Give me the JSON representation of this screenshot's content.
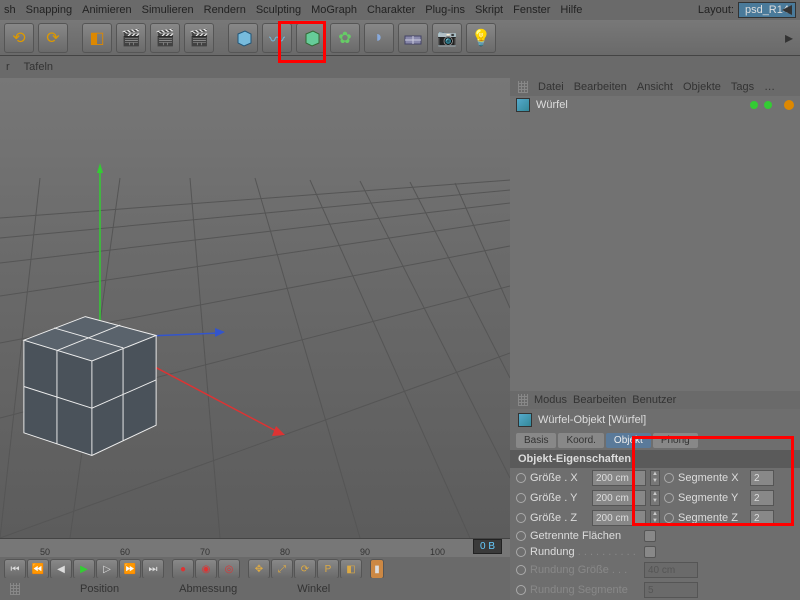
{
  "menu": {
    "items": [
      "sh",
      "Snapping",
      "Animieren",
      "Simulieren",
      "Rendern",
      "Sculpting",
      "MoGraph",
      "Charakter",
      "Plug-ins",
      "Skript",
      "Fenster",
      "Hilfe"
    ],
    "layout_label": "Layout:",
    "layout_value": "psd_R14"
  },
  "secondbar": {
    "items": [
      "r",
      "Tafeln"
    ]
  },
  "objmgr": {
    "menu": [
      "Datei",
      "Bearbeiten",
      "Ansicht",
      "Objekte",
      "Tags"
    ],
    "dots": "…",
    "item": "Würfel"
  },
  "attr": {
    "menu": [
      "Modus",
      "Bearbeiten",
      "Benutzer"
    ],
    "title": "Würfel-Objekt [Würfel]",
    "tabs": [
      "Basis",
      "Koord.",
      "Objekt",
      "Phong"
    ],
    "section": "Objekt-Eigenschaften",
    "rows": [
      {
        "l1": "Größe . X",
        "v1": "200 cm",
        "l2": "Segmente X",
        "v2": "2"
      },
      {
        "l1": "Größe . Y",
        "v1": "200 cm",
        "l2": "Segmente Y",
        "v2": "2"
      },
      {
        "l1": "Größe . Z",
        "v1": "200 cm",
        "l2": "Segmente Z",
        "v2": "2"
      }
    ],
    "sep": "Getrennte Flächen",
    "rnd": "Rundung",
    "rndsize": {
      "label": "Rundung Größe . . .",
      "value": "40 cm"
    },
    "rndseg": {
      "label": "Rundung Segmente",
      "value": "5"
    }
  },
  "timeline": {
    "ticks": [
      "50",
      "60",
      "70",
      "80",
      "90",
      "100"
    ],
    "frame": "0 B"
  },
  "bottom": {
    "cols": [
      "Position",
      "Abmessung",
      "Winkel"
    ]
  }
}
